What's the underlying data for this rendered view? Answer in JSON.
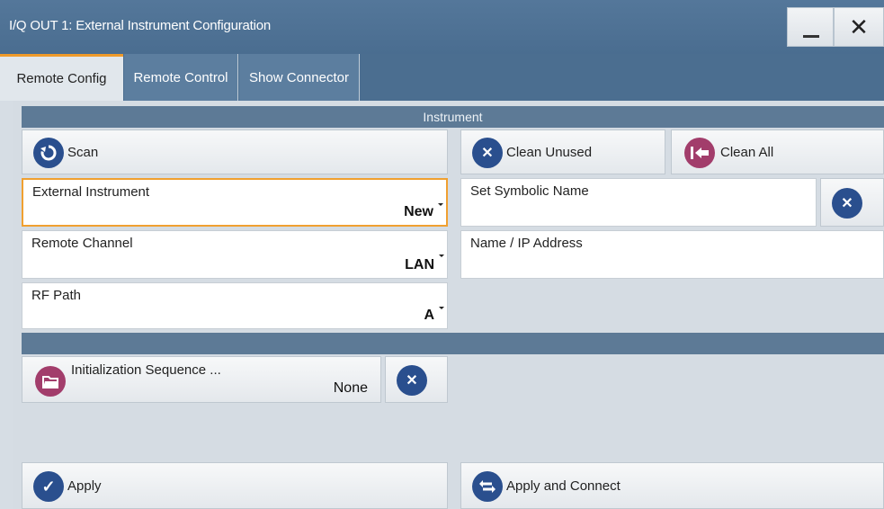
{
  "window": {
    "title": "I/Q OUT 1: External Instrument Configuration"
  },
  "titlebar": {
    "minimize_icon": "minimize-icon",
    "close_icon": "close-icon"
  },
  "tabs": [
    {
      "label": "Remote Config",
      "active": true
    },
    {
      "label": "Remote Control",
      "active": false
    },
    {
      "label": "Show Connector",
      "active": false
    }
  ],
  "instrument": {
    "header": "Instrument",
    "scan_label": "Scan",
    "clean_unused_label": "Clean Unused",
    "clean_all_label": "Clean All",
    "external_instrument": {
      "label": "External Instrument",
      "value": "New"
    },
    "remote_channel": {
      "label": "Remote Channel",
      "value": "LAN"
    },
    "rf_path": {
      "label": "RF Path",
      "value": "A"
    },
    "symbolic_name": {
      "label": "Set Symbolic Name",
      "value": ""
    },
    "ip_address": {
      "label": "Name / IP Address",
      "value": ""
    }
  },
  "init_sequence": {
    "label": "Initialization Sequence ...",
    "value": "None"
  },
  "footer": {
    "apply_label": "Apply",
    "apply_connect_label": "Apply and Connect"
  },
  "colors": {
    "accent": "#ee9a2a",
    "titlebar": "#4b6e90",
    "icon_blue": "#2a4f8e",
    "icon_maroon": "#a23d6b"
  }
}
